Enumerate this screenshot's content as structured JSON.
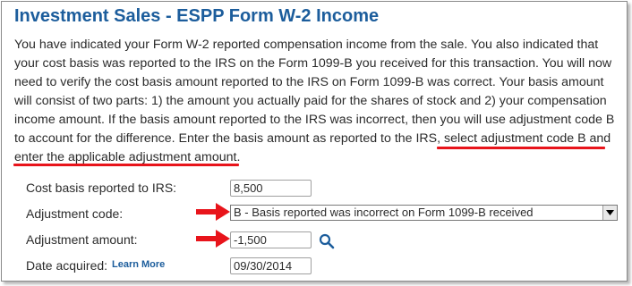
{
  "title": "Investment Sales - ESPP Form W-2 Income",
  "paragraph": {
    "main": "You have indicated your Form W-2 reported compensation income from the sale. You also indicated that your cost basis was reported to the IRS on the Form 1099-B you received for this transaction. You will now need to verify the cost basis amount reported to the IRS on Form 1099-B was correct. Your basis amount will consist of two parts: 1) the amount you actually paid for the shares of stock and 2) your compensation income amount. If the basis amount reported to the IRS was incorrect, then you will use adjustment code B to account for the difference. Enter the basis amount as reported to the IRS, ",
    "highlight": "select adjustment code B and enter the applicable adjustment amount",
    "end": "."
  },
  "form": {
    "cost_basis": {
      "label": "Cost basis reported to IRS:",
      "value": "8,500"
    },
    "adjustment_code": {
      "label": "Adjustment code:",
      "selected": "B - Basis reported was incorrect on Form 1099-B received"
    },
    "adjustment_amount": {
      "label": "Adjustment amount:",
      "value": "-1,500"
    },
    "date_acquired": {
      "label": "Date acquired:",
      "learn_more": "Learn More",
      "value": "09/30/2014"
    }
  },
  "colors": {
    "title": "#1c5d9c",
    "annotation": "#e8141b"
  },
  "icons": {
    "search": "magnifier-icon",
    "arrow": "red-arrow-icon",
    "dropdown": "dropdown-arrow-icon"
  }
}
